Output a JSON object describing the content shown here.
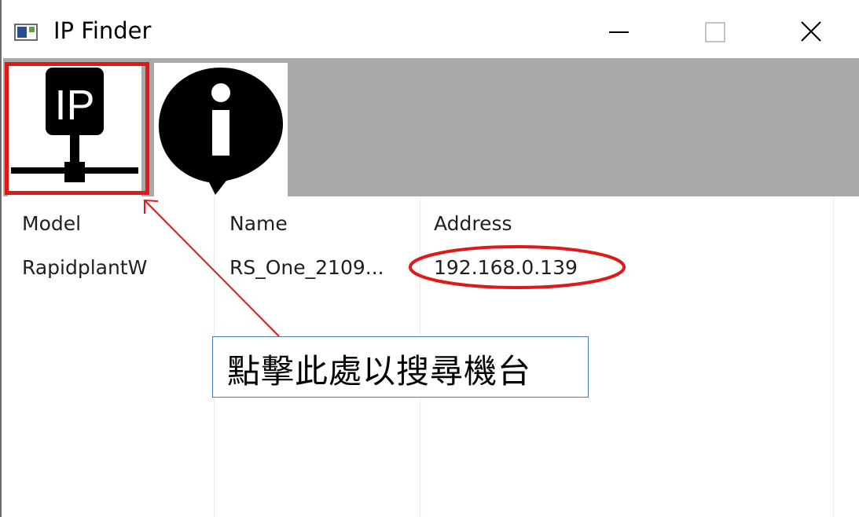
{
  "window": {
    "title": "IP Finder",
    "icon": "app-window-icon",
    "controls": [
      "minimize-icon",
      "maximize-icon",
      "close-icon"
    ]
  },
  "toolbar": {
    "buttons": [
      {
        "name": "ip-search",
        "icon": "ip-network-icon",
        "label": "IP"
      },
      {
        "name": "about",
        "icon": "info-bubble-icon"
      }
    ]
  },
  "table": {
    "columns": [
      "Model",
      "Name",
      "Address"
    ],
    "rows": [
      {
        "model": "RapidplantW",
        "name": "RS_One_2109...",
        "address": "192.168.0.139"
      }
    ]
  },
  "annotation": {
    "callout_text": "點擊此處以搜尋機台",
    "highlight_color": "#e01818",
    "callout_border_color": "#4a7ab8"
  }
}
